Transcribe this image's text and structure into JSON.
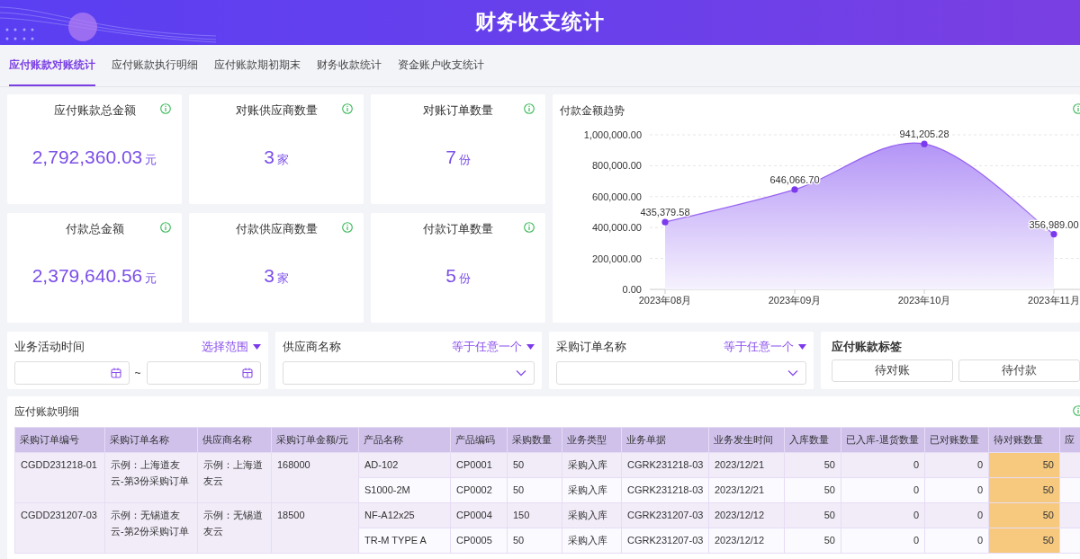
{
  "header": {
    "title": "财务收支统计"
  },
  "tabs": [
    {
      "label": "应付账款对账统计",
      "selected": true
    },
    {
      "label": "应付账款执行明细",
      "selected": false
    },
    {
      "label": "应付账款期初期末",
      "selected": false
    },
    {
      "label": "财务收款统计",
      "selected": false
    },
    {
      "label": "资金账户收支统计",
      "selected": false
    }
  ],
  "stats": [
    {
      "label": "应付账款总金额",
      "value": "2,792,360.03",
      "unit": "元"
    },
    {
      "label": "对账供应商数量",
      "value": "3",
      "unit": "家"
    },
    {
      "label": "对账订单数量",
      "value": "7",
      "unit": "份"
    },
    {
      "label": "付款总金额",
      "value": "2,379,640.56",
      "unit": "元"
    },
    {
      "label": "付款供应商数量",
      "value": "3",
      "unit": "家"
    },
    {
      "label": "付款订单数量",
      "value": "5",
      "unit": "份"
    }
  ],
  "trend": {
    "title": "付款金额趋势",
    "chart_data": {
      "type": "area",
      "categories": [
        "2023年08月",
        "2023年09月",
        "2023年10月",
        "2023年11月"
      ],
      "series": [
        {
          "color": "#7c3aed",
          "values": [
            435000,
            646000,
            941000,
            357000
          ]
        }
      ],
      "ylim": [
        0,
        1000000
      ],
      "grid": true,
      "yticks": [
        {
          "value": 0,
          "label": "0.00"
        },
        {
          "value": 200000,
          "label": "200,000.00"
        },
        {
          "value": 400000,
          "label": "400,000.00"
        },
        {
          "value": 600000,
          "label": "600,000.00"
        },
        {
          "value": 800000,
          "label": "800,000.00"
        },
        {
          "value": 1000000,
          "label": "1,000,000.00"
        }
      ],
      "value_labels": [
        "435,379.58",
        "646,066.70",
        "941,205.28",
        "356,989.00"
      ]
    }
  },
  "filters": [
    {
      "kind": "daterange",
      "label": "业务活动时间",
      "mode": "选择范围",
      "separator": "~"
    },
    {
      "kind": "select",
      "label": "供应商名称",
      "mode": "等于任意一个"
    },
    {
      "kind": "select",
      "label": "采购订单名称",
      "mode": "等于任意一个"
    }
  ],
  "tags": {
    "title": "应付账款标签",
    "buttons": [
      "待对账",
      "待付款"
    ]
  },
  "table": {
    "title": "应付账款明细",
    "columns": [
      {
        "label": "采购订单编号",
        "kind": "text",
        "highlight": false
      },
      {
        "label": "采购订单名称",
        "kind": "text",
        "highlight": false
      },
      {
        "label": "供应商名称",
        "kind": "text",
        "highlight": false
      },
      {
        "label": "采购订单金额/元",
        "kind": "text",
        "highlight": false
      },
      {
        "label": "产品名称",
        "kind": "text",
        "highlight": false
      },
      {
        "label": "产品编码",
        "kind": "text",
        "highlight": false
      },
      {
        "label": "采购数量",
        "kind": "text",
        "highlight": false
      },
      {
        "label": "业务类型",
        "kind": "text",
        "highlight": false
      },
      {
        "label": "业务单据",
        "kind": "text",
        "highlight": false
      },
      {
        "label": "业务发生时间",
        "kind": "text",
        "highlight": false
      },
      {
        "label": "入库数量",
        "kind": "number",
        "highlight": false
      },
      {
        "label": "已入库-退货数量",
        "kind": "number",
        "highlight": false
      },
      {
        "label": "已对账数量",
        "kind": "number",
        "highlight": false
      },
      {
        "label": "待对账数量",
        "kind": "number",
        "highlight": true
      },
      {
        "label": "应",
        "kind": "text",
        "highlight": false
      }
    ],
    "orders": [
      {
        "cells": [
          "CGDD231218-01",
          "示例：上海道友云-第3份采购订单",
          "示例：上海道友云",
          "168000"
        ],
        "items": [
          [
            "AD-102",
            "CP0001",
            "50",
            "采购入库",
            "CGRK231218-03",
            "2023/12/21",
            "50",
            "0",
            "0",
            "50"
          ],
          [
            "S1000-2M",
            "CP0002",
            "50",
            "采购入库",
            "CGRK231218-03",
            "2023/12/21",
            "50",
            "0",
            "0",
            "50"
          ]
        ]
      },
      {
        "cells": [
          "CGDD231207-03",
          "示例：无锡道友云-第2份采购订单",
          "示例：无锡道友云",
          "18500"
        ],
        "items": [
          [
            "NF-A12x25",
            "CP0004",
            "150",
            "采购入库",
            "CGRK231207-03",
            "2023/12/12",
            "50",
            "0",
            "0",
            "50"
          ],
          [
            "TR-M TYPE A",
            "CP0005",
            "50",
            "采购入库",
            "CGRK231207-03",
            "2023/12/12",
            "50",
            "0",
            "0",
            "50"
          ]
        ]
      }
    ]
  }
}
